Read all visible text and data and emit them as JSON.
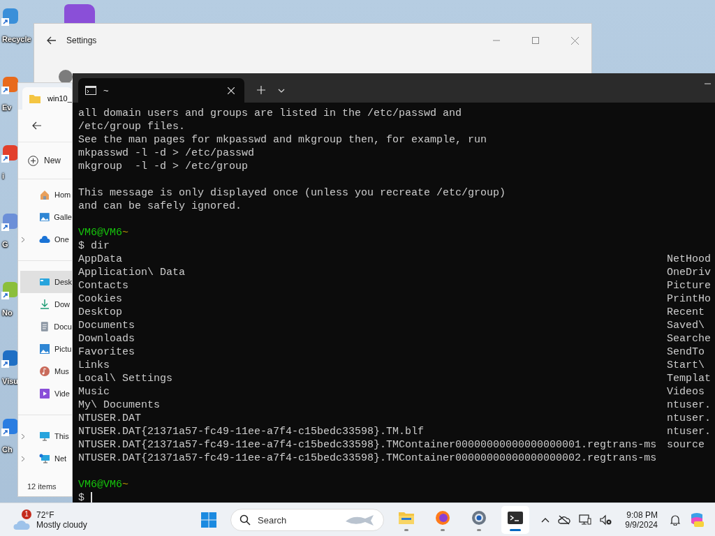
{
  "desktop_icons": [
    {
      "label": "Recycle",
      "color": "#3a8fd9"
    },
    {
      "label": "Ev",
      "color": "#e86a1c"
    },
    {
      "label": "i",
      "color": "#e2402c"
    },
    {
      "label": "G",
      "color": "#6c8fd8"
    },
    {
      "label": "No",
      "color": "#8bbf3c"
    },
    {
      "label": "Visu",
      "color": "#1f6fc4"
    },
    {
      "label": "Ch",
      "color": "#2a7de1"
    }
  ],
  "settings": {
    "title": "Settings"
  },
  "explorer": {
    "tab": "win10_",
    "new_button": "New",
    "nav": [
      {
        "label": "Hom",
        "kind": "home",
        "expandable": false,
        "selected": false
      },
      {
        "label": "Galle",
        "kind": "gallery",
        "expandable": false,
        "selected": false
      },
      {
        "label": "One",
        "kind": "cloud",
        "expandable": true,
        "selected": false
      },
      {
        "kind": "divider"
      },
      {
        "label": "Desk",
        "kind": "desktop",
        "expandable": false,
        "selected": true
      },
      {
        "label": "Dow",
        "kind": "download",
        "expandable": false,
        "selected": false
      },
      {
        "label": "Docu",
        "kind": "document",
        "expandable": false,
        "selected": false
      },
      {
        "label": "Pictu",
        "kind": "pictures",
        "expandable": false,
        "selected": false
      },
      {
        "label": "Mus",
        "kind": "music",
        "expandable": false,
        "selected": false
      },
      {
        "label": "Vide",
        "kind": "video",
        "expandable": false,
        "selected": false
      },
      {
        "kind": "divider"
      },
      {
        "label": "This",
        "kind": "pc",
        "expandable": true,
        "selected": false
      },
      {
        "label": "Net",
        "kind": "network",
        "expandable": true,
        "selected": false
      }
    ],
    "status": "12 items"
  },
  "terminal": {
    "tab_title": "~",
    "lines": [
      {
        "kind": "text",
        "text": "all domain users and groups are listed in the /etc/passwd and"
      },
      {
        "kind": "text",
        "text": "/etc/group files."
      },
      {
        "kind": "text",
        "text": "See the man pages for mkpasswd and mkgroup then, for example, run"
      },
      {
        "kind": "text",
        "text": "mkpasswd -l -d > /etc/passwd"
      },
      {
        "kind": "text",
        "text": "mkgroup  -l -d > /etc/group"
      },
      {
        "kind": "blank"
      },
      {
        "kind": "text",
        "text": "This message is only displayed once (unless you recreate /etc/group)"
      },
      {
        "kind": "text",
        "text": "and can be safely ignored."
      },
      {
        "kind": "blank"
      },
      {
        "kind": "prompt",
        "user": "VM6@VM6",
        "path": "~"
      },
      {
        "kind": "command",
        "text": "$ dir"
      },
      {
        "kind": "listing",
        "left": "AppData",
        "right": "NetHood"
      },
      {
        "kind": "listing",
        "left": "Application\\ Data",
        "right": "OneDriv"
      },
      {
        "kind": "listing",
        "left": "Contacts",
        "right": "Picture"
      },
      {
        "kind": "listing",
        "left": "Cookies",
        "right": "PrintHo"
      },
      {
        "kind": "listing",
        "left": "Desktop",
        "right": "Recent"
      },
      {
        "kind": "listing",
        "left": "Documents",
        "right": "Saved\\"
      },
      {
        "kind": "listing",
        "left": "Downloads",
        "right": "Searche"
      },
      {
        "kind": "listing",
        "left": "Favorites",
        "right": "SendTo"
      },
      {
        "kind": "listing",
        "left": "Links",
        "right": "Start\\"
      },
      {
        "kind": "listing",
        "left": "Local\\ Settings",
        "right": "Templat"
      },
      {
        "kind": "listing",
        "left": "Music",
        "right": "Videos"
      },
      {
        "kind": "listing",
        "left": "My\\ Documents",
        "right": "ntuser."
      },
      {
        "kind": "listing",
        "left": "NTUSER.DAT",
        "right": "ntuser."
      },
      {
        "kind": "listing",
        "left": "NTUSER.DAT{21371a57-fc49-11ee-a7f4-c15bedc33598}.TM.blf",
        "right": "ntuser."
      },
      {
        "kind": "listing",
        "left": "NTUSER.DAT{21371a57-fc49-11ee-a7f4-c15bedc33598}.TMContainer00000000000000000001.regtrans-ms",
        "right": "source"
      },
      {
        "kind": "listing",
        "left": "NTUSER.DAT{21371a57-fc49-11ee-a7f4-c15bedc33598}.TMContainer00000000000000000002.regtrans-ms"
      },
      {
        "kind": "blank"
      },
      {
        "kind": "prompt",
        "user": "VM6@VM6",
        "path": "~"
      },
      {
        "kind": "input",
        "text": "$"
      }
    ]
  },
  "taskbar": {
    "weather": {
      "badge": "1",
      "temp": "72°F",
      "condition": "Mostly cloudy"
    },
    "search": "Search",
    "apps": [
      {
        "kind": "folder",
        "active": false
      },
      {
        "kind": "firefox",
        "active": false
      },
      {
        "kind": "settings",
        "active": false
      },
      {
        "kind": "terminal",
        "active": true
      }
    ],
    "time": "9:08 PM",
    "date": "9/9/2024"
  }
}
